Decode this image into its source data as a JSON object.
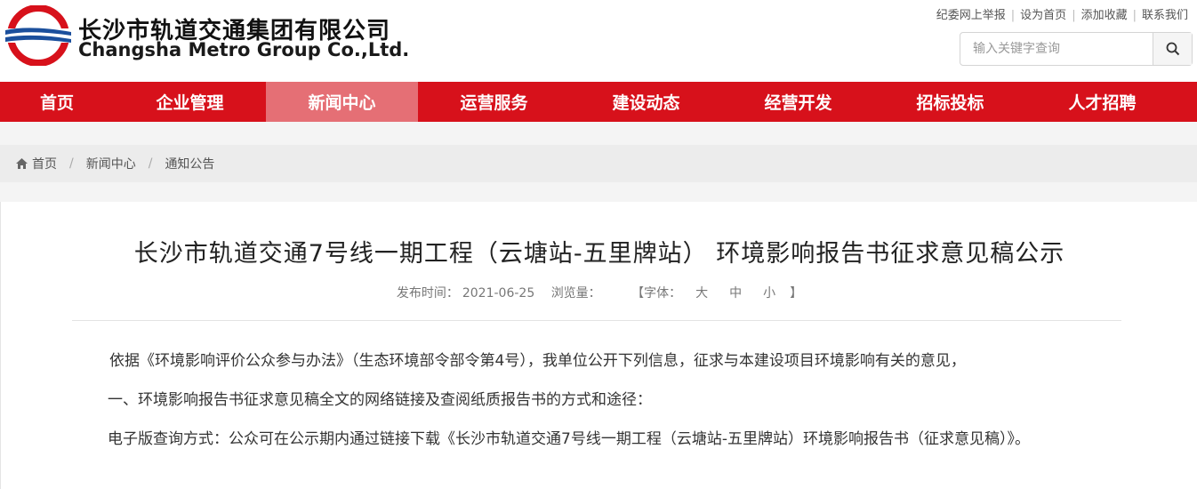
{
  "brand": {
    "name_cn": "长沙市轨道交通集团有限公司",
    "name_en": "Changsha Metro Group Co.,Ltd."
  },
  "toplinks": [
    "纪委网上举报",
    "设为首页",
    "添加收藏",
    "联系我们"
  ],
  "search": {
    "placeholder": "输入关键字查询",
    "icon": "search-icon"
  },
  "nav": {
    "items": [
      "首页",
      "企业管理",
      "新闻中心",
      "运营服务",
      "建设动态",
      "经营开发",
      "招标投标",
      "人才招聘"
    ],
    "active": "新闻中心",
    "color": "#d7111b"
  },
  "breadcrumb": [
    "首页",
    "新闻中心",
    "通知公告"
  ],
  "article": {
    "title": "长沙市轨道交通7号线一期工程（云塘站-五里牌站） 环境影响报告书征求意见稿公示",
    "meta": {
      "date_label": "发布时间：",
      "date": "2021-06-25",
      "views_label": "浏览量：",
      "font_open": "【字体：",
      "font_large": "大",
      "font_medium": "中",
      "font_small": "小",
      "font_close": "】"
    },
    "paragraphs": [
      "依据《环境影响评价公众参与办法》（生态环境部令部令第4号），我单位公开下列信息，征求与本建设项目环境影响有关的意见，",
      "一、环境影响报告书征求意见稿全文的网络链接及查阅纸质报告书的方式和途径：",
      "电子版查询方式：公众可在公示期内通过链接下载《长沙市轨道交通7号线一期工程（云塘站-五里牌站）环境影响报告书（征求意见稿）》。"
    ]
  }
}
